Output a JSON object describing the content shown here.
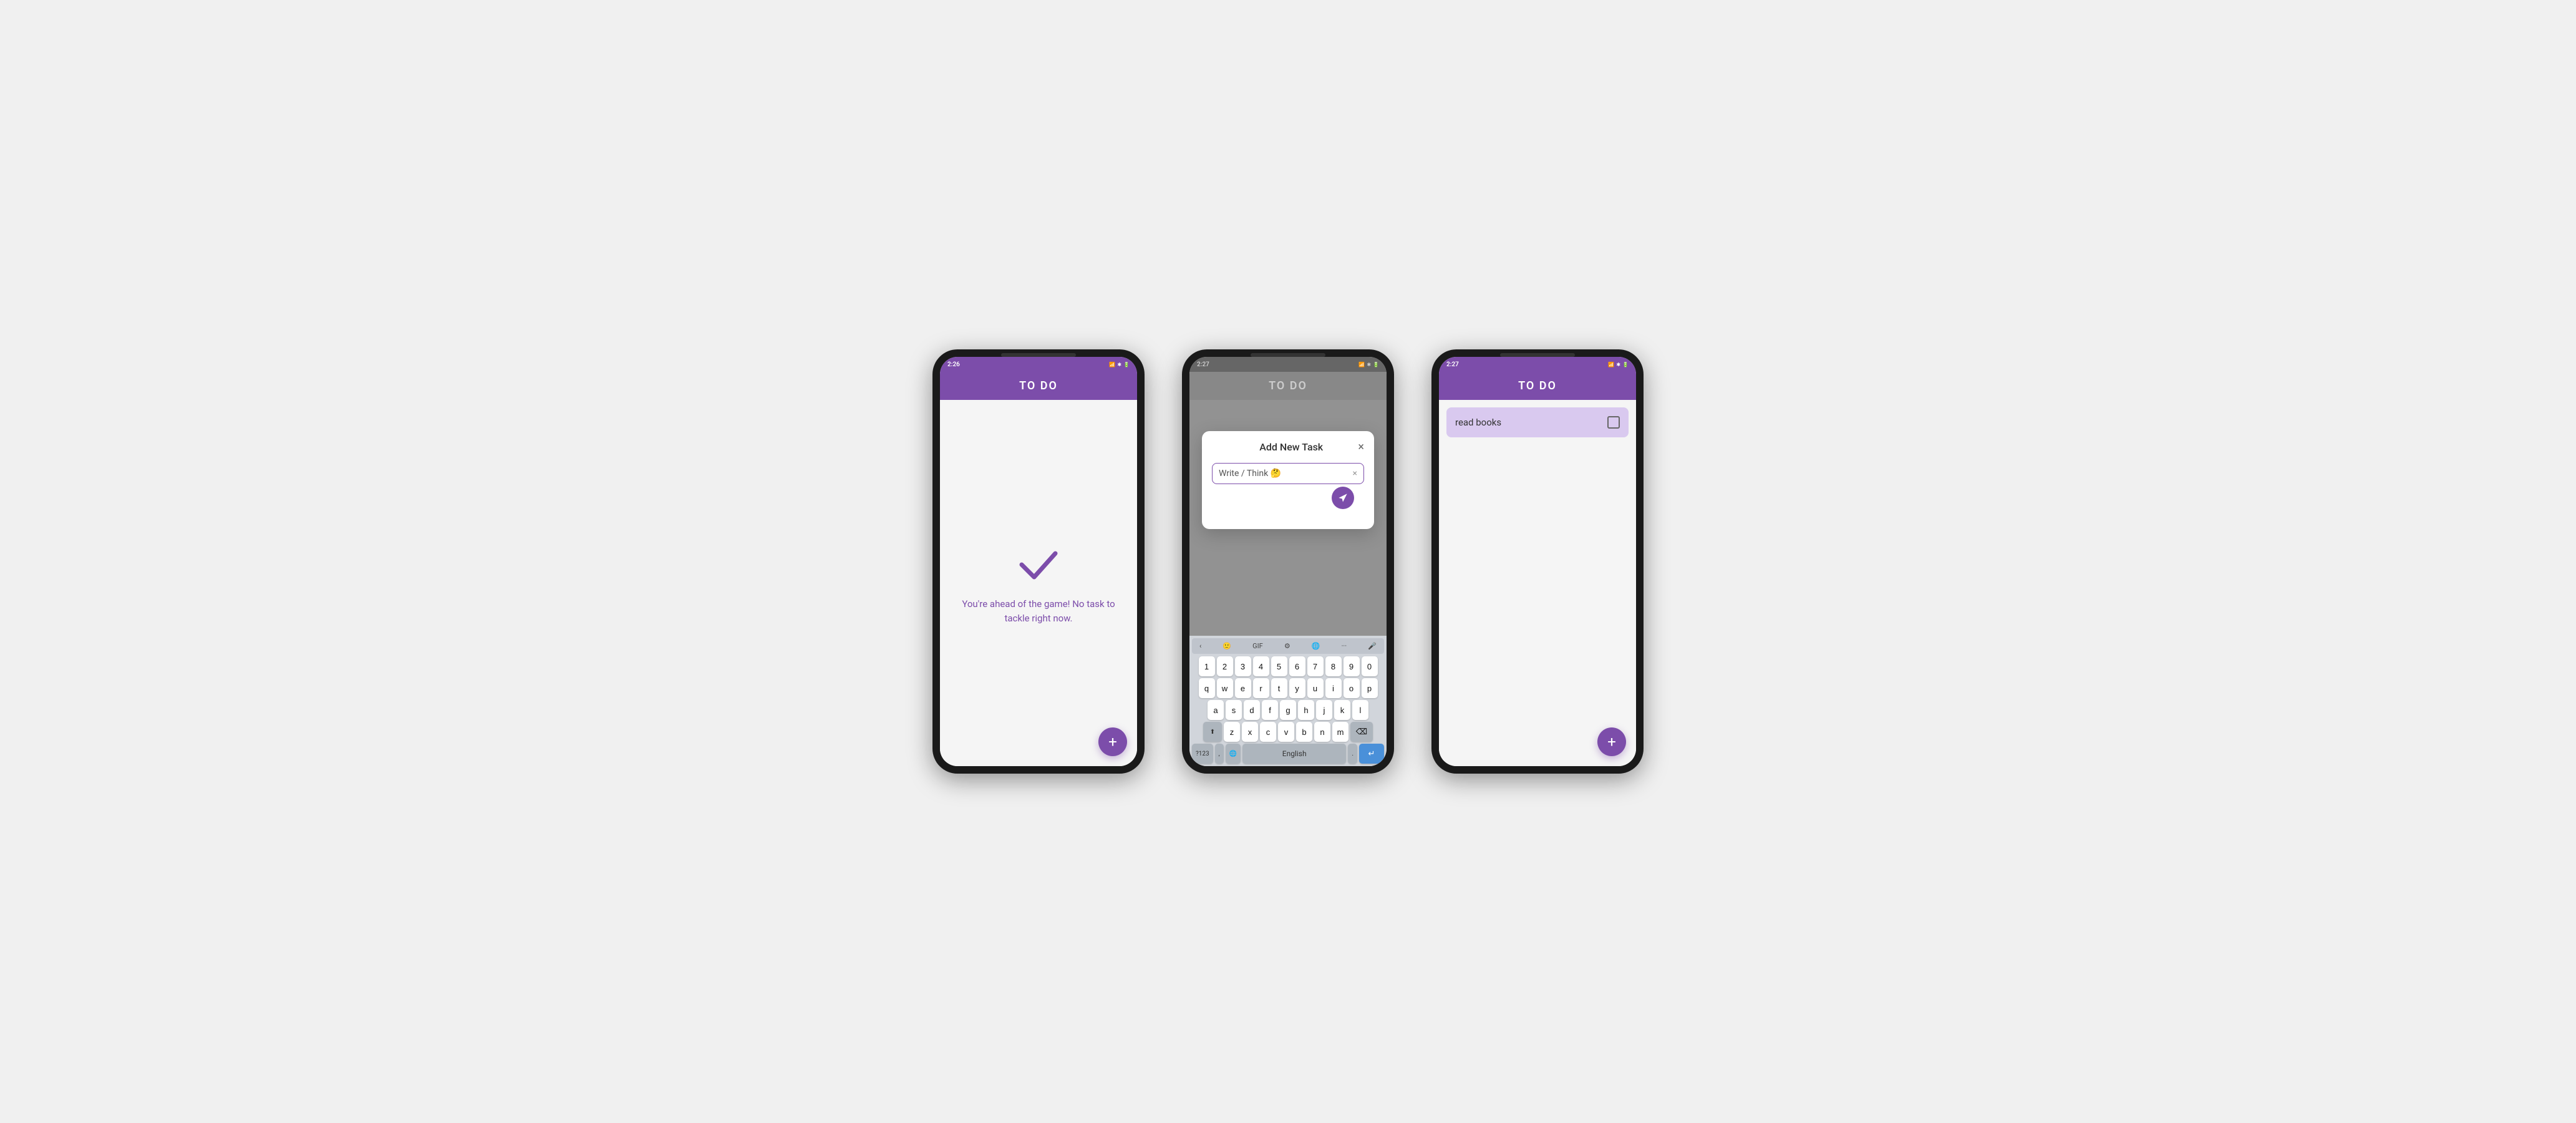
{
  "screen1": {
    "status_time": "2:26",
    "header_title": "TO DO",
    "empty_message": "You're ahead of the game! No task to tackle right now.",
    "fab_label": "+",
    "status_icons": "📶 ✱ 🔋"
  },
  "screen2": {
    "status_time": "2:27",
    "header_title": "TO DO",
    "modal_title": "Add New Task",
    "modal_close": "×",
    "input_value": "Write / Think 🤔",
    "input_clear": "×",
    "fab_label": "+",
    "keyboard": {
      "row_numbers": [
        "1",
        "2",
        "3",
        "4",
        "5",
        "6",
        "7",
        "8",
        "9",
        "0"
      ],
      "row1": [
        "q",
        "w",
        "e",
        "r",
        "t",
        "y",
        "u",
        "i",
        "o",
        "p"
      ],
      "row2": [
        "a",
        "s",
        "d",
        "f",
        "g",
        "h",
        "j",
        "k",
        "l"
      ],
      "row3": [
        "z",
        "x",
        "c",
        "v",
        "b",
        "n",
        "m"
      ],
      "bottom_special": "?123",
      "bottom_lang": "English",
      "bottom_period": ".",
      "toolbar_gif": "GIF",
      "toolbar_settings": "⚙",
      "toolbar_translate": "🌐",
      "toolbar_more": "···",
      "toolbar_mic": "🎤"
    }
  },
  "screen3": {
    "status_time": "2:27",
    "header_title": "TO DO",
    "task_text": "read books",
    "fab_label": "+"
  }
}
